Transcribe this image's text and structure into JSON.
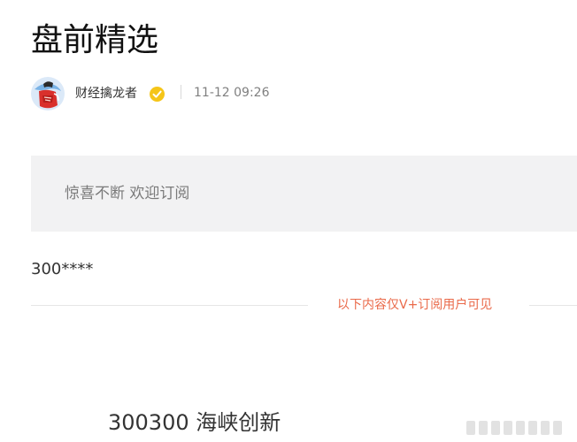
{
  "article": {
    "title": "盘前精选"
  },
  "author": {
    "name": "财经擒龙者",
    "avatar_icon": "author-avatar",
    "verified_icon": "verified-badge-icon",
    "verified_color": "#f5c518",
    "publish_time": "11-12 09:26"
  },
  "notice": {
    "text": "惊喜不断 欢迎订阅"
  },
  "content": {
    "stock_code": "300****",
    "vip_notice": "以下内容仅V+订阅用户可见",
    "vip_color": "#ea6a4a",
    "stock_headline": "300300 海峡创新"
  }
}
